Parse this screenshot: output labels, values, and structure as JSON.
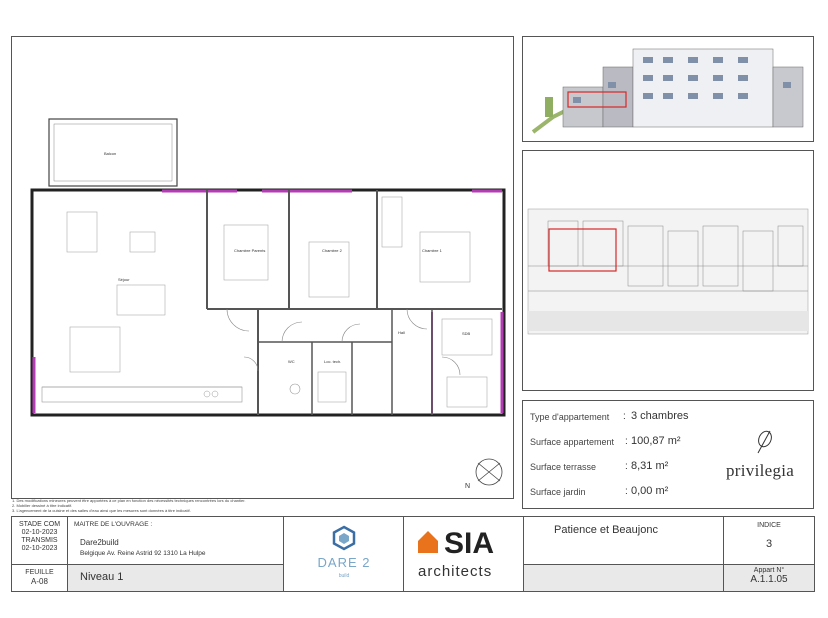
{
  "plan": {
    "rooms": {
      "balcon": "Balcon",
      "sejour": "Séjour",
      "chambre_parents": "Chambre Parents",
      "chambre2": "Chambre 2",
      "chambre1": "Chambre 1",
      "hall": "Hall",
      "sdb": "SDB",
      "wc": "WC",
      "loc_tech": "Loc. tech."
    },
    "north": "N"
  },
  "notes": [
    "1. Des modifications mineures peuvent être apportées à ce plan en fonction des nécessités techniques rencontrées lors du chantier.",
    "2. Mobilier dessiné à titre indicatif.",
    "3. L'agencement de la cuisine et des salles d'eau ainsi que les mesures sont données à titre indicatif."
  ],
  "info": {
    "rows": [
      {
        "label": "Type d'appartement",
        "sep": ":",
        "value": "3 chambres"
      },
      {
        "label": "Surface appartement",
        "sep": ":",
        "value": "100,87 m²"
      },
      {
        "label": "Surface terrasse",
        "sep": ":",
        "value": "8,31 m²"
      },
      {
        "label": "Surface jardin",
        "sep": ":",
        "value": "0,00 m²"
      }
    ],
    "brand": "privilegia"
  },
  "title_block": {
    "stade_label": "STADE COM",
    "stade_date": "02-10-2023",
    "transmis_label": "TRANSMIS",
    "transmis_date": "02-10-2023",
    "feuille_label": "FEUILLE",
    "feuille": "A-08",
    "maitre_label": "MAITRE DE L'OUVRAGE :",
    "maitre_name": "Dare2build",
    "maitre_address": "Belgique Av. Reine Astrid 92   1310 La Hulpe",
    "niveau": "Niveau 1",
    "dare_logo": "DARE 2",
    "dare_sub": "build",
    "sia": "SIA",
    "sia_sub": "architects",
    "project": "Patience et Beaujonc",
    "indice_label": "INDICE",
    "indice": "3",
    "appart_label": "Appart N°",
    "appart": "A.1.1.05"
  },
  "colors": {
    "accent_wall": "#b43cb4",
    "highlight": "#d62828",
    "sia_orange": "#e8731c",
    "dare_blue": "#7aa6c8"
  }
}
